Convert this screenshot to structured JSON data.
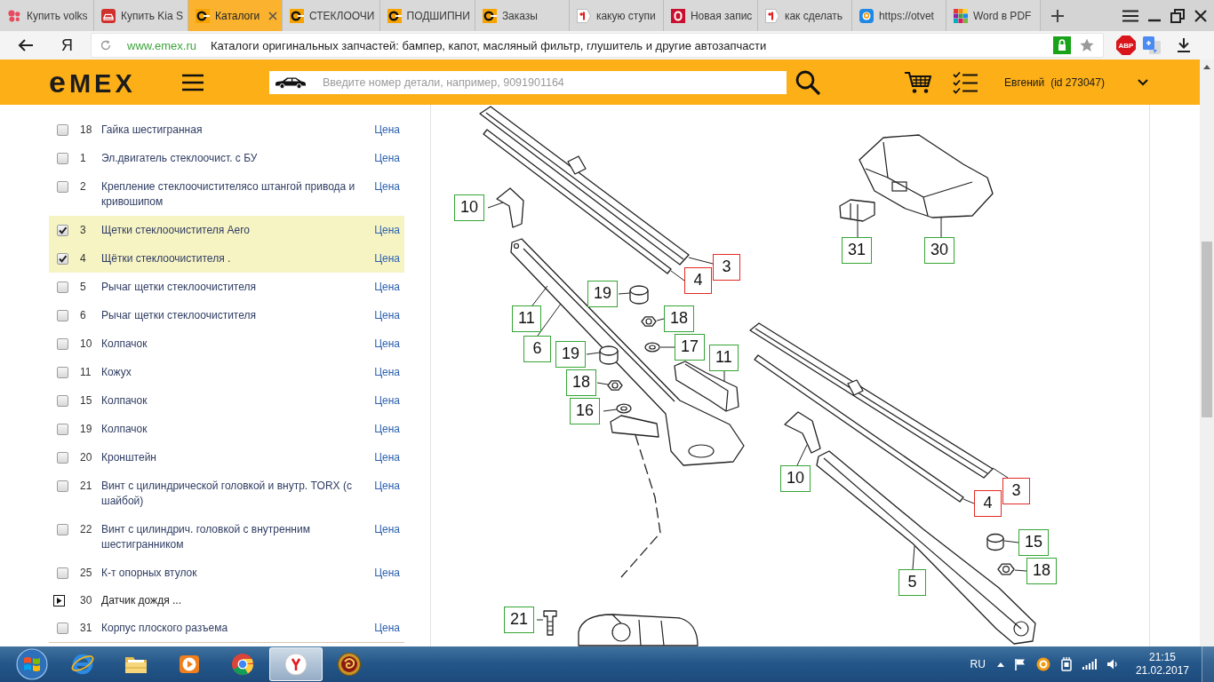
{
  "browser": {
    "tabs": [
      {
        "title": "Купить volks",
        "selected": false
      },
      {
        "title": "Купить Kia S",
        "selected": false
      },
      {
        "title": "Каталоги",
        "selected": true
      },
      {
        "title": "СТЕКЛООЧИ",
        "selected": false
      },
      {
        "title": "ПОДШИПНИ",
        "selected": false
      },
      {
        "title": "Заказы",
        "selected": false
      },
      {
        "title": "какую ступи",
        "selected": false
      },
      {
        "title": "Новая запис",
        "selected": false
      },
      {
        "title": "как сделать",
        "selected": false
      },
      {
        "title": "https://otvet",
        "selected": false
      },
      {
        "title": "Word в PDF",
        "selected": false
      }
    ],
    "toolbar": {
      "browser_button": "Я",
      "host": "www.emex.ru",
      "page_title": "Каталоги оригинальных запчастей: бампер, капот, масляный фильтр, глушитель и другие автозапчасти",
      "adblock_badge": "ABP"
    }
  },
  "site_header": {
    "logo": "eMEX",
    "search": {
      "placeholder": "Введите номер детали, например, 9091901164"
    },
    "user_name": "Евгений",
    "user_id": "(id 273047)"
  },
  "parts_list": [
    {
      "kind": "part",
      "number": "18",
      "name": "Гайка шестигранная",
      "checked": false,
      "price_link": "Цена"
    },
    {
      "kind": "part",
      "number": "1",
      "name": "Эл.двигатель стеклоочист. с БУ",
      "checked": false,
      "price_link": "Цена"
    },
    {
      "kind": "part",
      "number": "2",
      "name": "Крепление стеклоочистителясо штангой привода и кривошипом",
      "checked": false,
      "price_link": "Цена"
    },
    {
      "kind": "part",
      "number": "3",
      "name": "Щетки стеклоочистителя Aero",
      "checked": true,
      "price_link": "Цена"
    },
    {
      "kind": "part",
      "number": "4",
      "name": "Щётки стеклоочистителя .",
      "checked": true,
      "price_link": "Цена"
    },
    {
      "kind": "part",
      "number": "5",
      "name": "Рычаг щетки стеклоочистителя",
      "checked": false,
      "price_link": "Цена"
    },
    {
      "kind": "part",
      "number": "6",
      "name": "Рычаг щетки стеклоочистителя",
      "checked": false,
      "price_link": "Цена"
    },
    {
      "kind": "part",
      "number": "10",
      "name": "Колпачок",
      "checked": false,
      "price_link": "Цена"
    },
    {
      "kind": "part",
      "number": "11",
      "name": "Кожух",
      "checked": false,
      "price_link": "Цена"
    },
    {
      "kind": "part",
      "number": "15",
      "name": "Колпачок",
      "checked": false,
      "price_link": "Цена"
    },
    {
      "kind": "part",
      "number": "19",
      "name": "Колпачок",
      "checked": false,
      "price_link": "Цена"
    },
    {
      "kind": "part",
      "number": "20",
      "name": "Кронштейн",
      "checked": false,
      "price_link": "Цена"
    },
    {
      "kind": "part",
      "number": "21",
      "name": "Винт с цилиндрической головкой и внутр. TORX (с шайбой)",
      "checked": false,
      "price_link": "Цена"
    },
    {
      "kind": "part",
      "number": "22",
      "name": "Винт с цилиндрич. головкой с внутренним шестигранником",
      "checked": false,
      "price_link": "Цена"
    },
    {
      "kind": "part",
      "number": "25",
      "name": "К-т опорных втулок",
      "checked": false,
      "price_link": "Цена"
    },
    {
      "kind": "group",
      "number": "30",
      "name": "Датчик дождя ...",
      "expanded": false
    },
    {
      "kind": "part",
      "number": "31",
      "name": "Корпус плоского разъема",
      "checked": false,
      "price_link": "Цена"
    }
  ],
  "diagram": {
    "callouts": [
      {
        "label": "10",
        "selected": false
      },
      {
        "label": "31",
        "selected": false
      },
      {
        "label": "30",
        "selected": false
      },
      {
        "label": "4",
        "selected": true
      },
      {
        "label": "3",
        "selected": true
      },
      {
        "label": "19",
        "selected": false
      },
      {
        "label": "11",
        "selected": false
      },
      {
        "label": "18",
        "selected": false
      },
      {
        "label": "6",
        "selected": false
      },
      {
        "label": "19",
        "selected": false
      },
      {
        "label": "17",
        "selected": false
      },
      {
        "label": "11",
        "selected": false
      },
      {
        "label": "18",
        "selected": false
      },
      {
        "label": "16",
        "selected": false
      },
      {
        "label": "10",
        "selected": false
      },
      {
        "label": "4",
        "selected": true
      },
      {
        "label": "3",
        "selected": true
      },
      {
        "label": "15",
        "selected": false
      },
      {
        "label": "5",
        "selected": false
      },
      {
        "label": "18",
        "selected": false
      },
      {
        "label": "21",
        "selected": false
      }
    ]
  },
  "taskbar": {
    "apps": [
      {
        "selected": false
      },
      {
        "selected": false
      },
      {
        "selected": false
      },
      {
        "selected": false
      },
      {
        "selected": true
      },
      {
        "selected": false
      }
    ],
    "language": "RU",
    "time": "21:15",
    "date": "21.02.2017"
  }
}
